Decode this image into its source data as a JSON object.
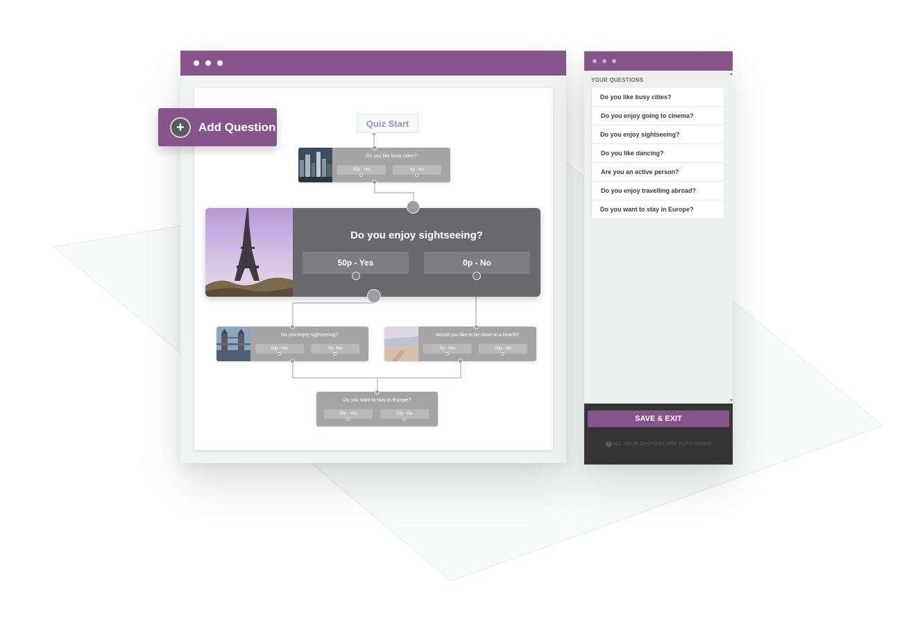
{
  "add_question": {
    "label": "Add Question"
  },
  "flow": {
    "start_label": "Quiz Start",
    "cards": [
      {
        "question": "Do you like busy cities?",
        "answers": [
          "50p - Yes",
          "0p - No"
        ],
        "image": "city-skyline-night"
      },
      {
        "question": "Do you enjoy sightseeing?",
        "answers": [
          "50p - Yes",
          "0p - No"
        ],
        "image": "eiffel-tower"
      },
      {
        "question": "Do you enjoy sightseeing?",
        "answers": [
          "50p - Yes",
          "0p - No"
        ],
        "image": "tower-bridge"
      },
      {
        "question": "Would you like to be close to a beach?",
        "answers": [
          "0p - Yes",
          "50p - No"
        ],
        "image": "beach"
      },
      {
        "question": "Do you want to stay in Europe?",
        "answers": [
          "50p - Yes",
          "50p - No"
        ],
        "image": "none"
      }
    ]
  },
  "sidebar": {
    "heading": "YOUR QUESTIONS",
    "questions": [
      "Do you like busy cities?",
      "Do you enjoy going to cinema?",
      "Do you enjoy sightseeing?",
      "Do you like dancing?",
      "Are you an active person?",
      "Do you enjoy travelling abroad?",
      "Do you want to stay in Europe?"
    ],
    "save_label": "SAVE & EXIT",
    "autosave_text": "ALL YOUR CHANGES ARE AUTO SAVED"
  },
  "colors": {
    "accent": "#87558c",
    "card": "#a5a5a5",
    "card_active": "#69696b",
    "connector": "#c3a3c9"
  }
}
